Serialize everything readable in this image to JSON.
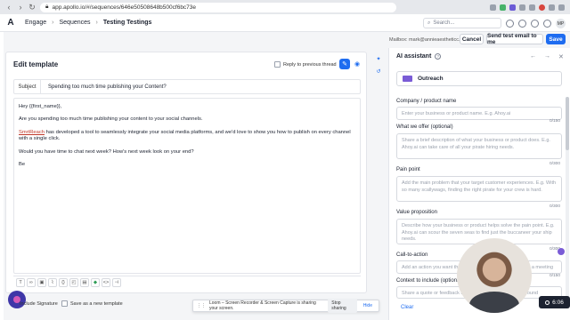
{
  "browser": {
    "url": "app.apollo.io/#/sequences/646e50508648b500cf6bc73e"
  },
  "header": {
    "breadcrumbs": [
      "Engage",
      "Sequences",
      "Testing Testings"
    ],
    "search_placeholder": "Search...",
    "avatar_initials": "MP"
  },
  "actions": {
    "mailbox": "Mailbox: mark@annieaestheticc.com",
    "cancel": "Cancel",
    "send_test": "Send test email to me",
    "save": "Save"
  },
  "editor": {
    "title": "Edit template",
    "reply_to_previous": "Reply to previous thread",
    "subject_label": "Subject",
    "subject_value": "Spending too much time publishing your Content?",
    "body": {
      "greeting": "Hey {{first_name}},",
      "line1": "Are you spending too much time publishing your content to your social channels.",
      "line2_link": "SmrtReach",
      "line2_rest": " has developed a tool to seamlessly integrate your social media platforms, and we'd love to show you how to publish on every channel with a single click.",
      "line3": "Would you have time to chat next week? How's next week look on your end?",
      "line4": "Be"
    },
    "toolbar_icons": [
      "text-format-icon",
      "link-icon",
      "image-icon",
      "attachment-icon",
      "variable-icon",
      "snippet-icon",
      "document-icon",
      "android-icon",
      "code-icon",
      "embed-icon"
    ],
    "include_signature": "Include Signature",
    "save_new_template": "Save as a new template"
  },
  "loom": {
    "message": "Loom – Screen Recorder & Screen Capture is sharing your screen.",
    "stop": "Stop sharing",
    "hide": "Hide"
  },
  "ai": {
    "title": "AI assistant",
    "preset": "Outreach",
    "fields": [
      {
        "label": "Company / product name",
        "placeholder": "Enter your business or product name. E.g. Ahoy.ai",
        "counter": "0/150"
      },
      {
        "label": "What we offer (optional)",
        "placeholder": "Share a brief description of what your business or product does. E.g. Ahoy.ai can take care of all your pirate hiring needs.",
        "counter": "0/300"
      },
      {
        "label": "Pain point",
        "placeholder": "Add the main problem that your target customer experiences. E.g. With so many scallywags, finding the right pirate for your crew is hard.",
        "counter": "0/300"
      },
      {
        "label": "Value proposition",
        "placeholder": "Describe how your business or product helps solve the pain point. E.g. Ahoy.ai can scour the seven seas to find just the buccaneer your ship needs.",
        "counter": "0/300"
      },
      {
        "label": "Call-to-action",
        "placeholder": "Add an action you want the prospect to take. E.g. Schedule a meeting",
        "counter": "0/150"
      },
      {
        "label": "Context to include (optional)",
        "placeholder": "Share a quote or feedback from a customer. E.g. Ahoy.ai found",
        "counter": ""
      }
    ],
    "clear": "Clear"
  },
  "clock": "6:06"
}
